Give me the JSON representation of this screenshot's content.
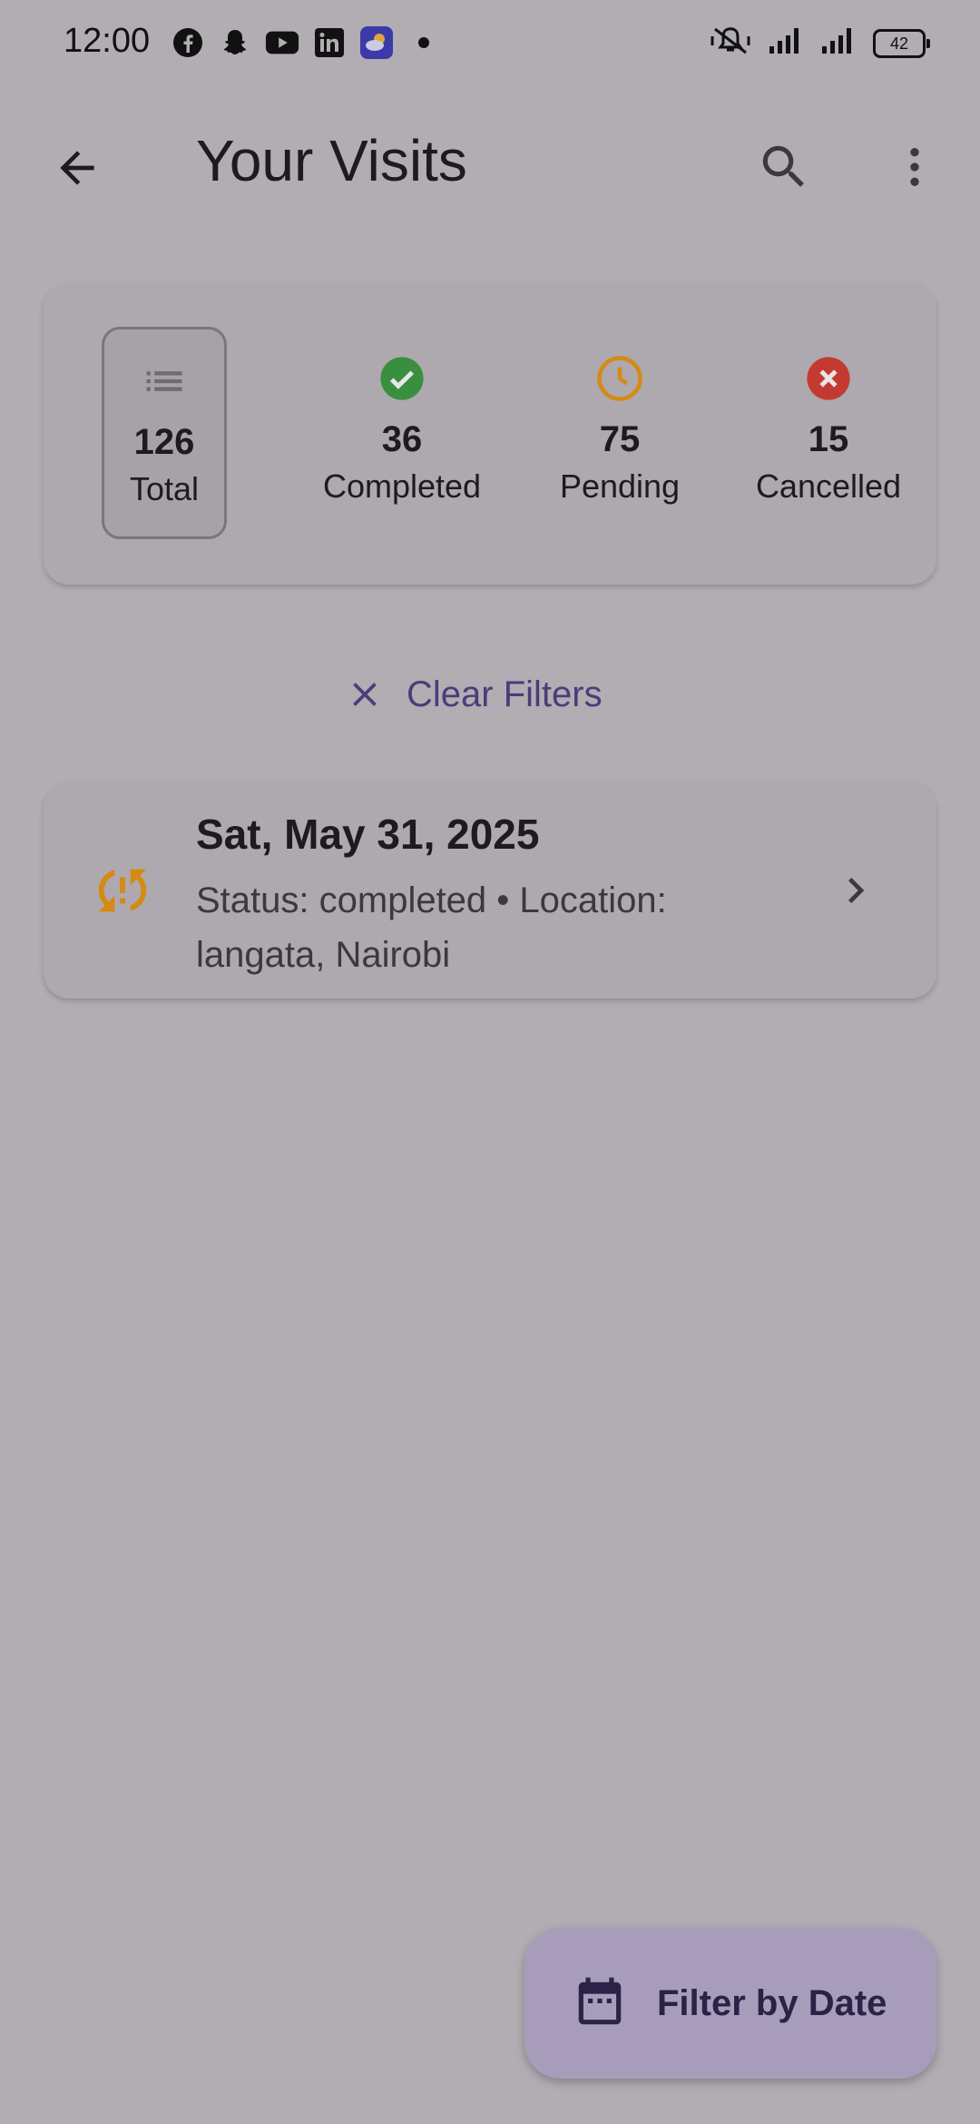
{
  "status_bar": {
    "time": "12:00",
    "battery": "42",
    "app_icons": [
      "facebook-icon",
      "snapchat-icon",
      "youtube-icon",
      "linkedin-icon",
      "weather-app-icon",
      "dot-icon"
    ],
    "right_icons": [
      "vibrate-off-icon",
      "signal-icon",
      "signal-icon",
      "battery-icon"
    ]
  },
  "app_bar": {
    "title": "Your Visits"
  },
  "stats": [
    {
      "label": "Total",
      "count": "126",
      "icon": "list-icon",
      "color": "#6f6b72",
      "selected": true
    },
    {
      "label": "Completed",
      "count": "36",
      "icon": "check-circle-icon",
      "color": "#3a8f3f",
      "selected": false
    },
    {
      "label": "Pending",
      "count": "75",
      "icon": "clock-icon",
      "color": "#d58a14",
      "selected": false
    },
    {
      "label": "Cancelled",
      "count": "15",
      "icon": "cancel-circle-icon",
      "color": "#c43a30",
      "selected": false
    }
  ],
  "clear_filters": {
    "label": "Clear Filters",
    "color": "#4a3d7a"
  },
  "visits": [
    {
      "date": "Sat, May 31, 2025",
      "subtitle": "Status: completed • Location: langata, Nairobi",
      "icon": "sync-problem-icon",
      "icon_color": "#d58a14"
    }
  ],
  "fab": {
    "label": "Filter by Date",
    "icon": "calendar-icon"
  },
  "colors": {
    "background": "#b1adb3",
    "card": "#ada9ae",
    "fab": "#a79dbb",
    "accent": "#4a3d7a"
  }
}
